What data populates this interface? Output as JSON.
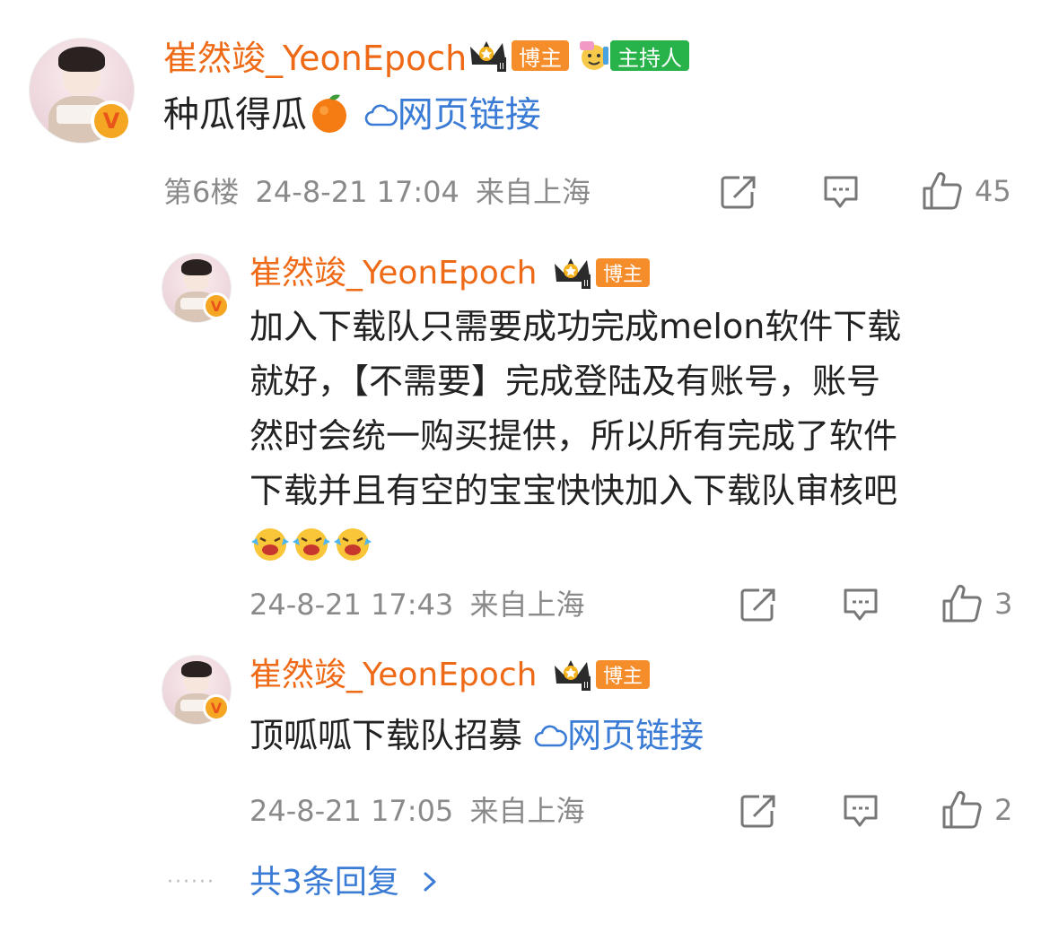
{
  "comments": [
    {
      "username": "崔然竣_YeonEpoch",
      "badge_blogger": "博主",
      "badge_host": "主持人",
      "text": "种瓜得瓜",
      "link_label": "网页链接",
      "floor": "第6楼",
      "time": "24-8-21 17:04",
      "location": "来自上海",
      "likes": "45"
    }
  ],
  "replies": [
    {
      "username": "崔然竣_YeonEpoch",
      "badge_blogger": "博主",
      "text_lines": [
        "加入下载队只需要成功完成melon软件下载",
        "就好，【不需要】完成登陆及有账号，账号",
        "然时会统一购买提供，所以所有完成了软件",
        "下载并且有空的宝宝快快加入下载队审核吧"
      ],
      "time": "24-8-21 17:43",
      "location": "来自上海",
      "likes": "3"
    },
    {
      "username": "崔然竣_YeonEpoch",
      "badge_blogger": "博主",
      "text": "顶呱呱下载队招募",
      "link_label": "网页链接",
      "time": "24-8-21 17:05",
      "location": "来自上海",
      "likes": "2"
    }
  ],
  "more_replies": "共3条回复",
  "icons": {
    "share": "share-icon",
    "comment": "comment-icon",
    "like": "like-icon",
    "link": "cloud-link-icon",
    "emoji_orange": "orange-emoji",
    "emoji_laugh": "laughing-cry-emoji"
  },
  "colors": {
    "username": "#ee6a16",
    "link": "#3a7bd5",
    "meta": "#8a8a8a",
    "blogger_badge": "#f58d2a",
    "host_badge": "#27b34a"
  }
}
